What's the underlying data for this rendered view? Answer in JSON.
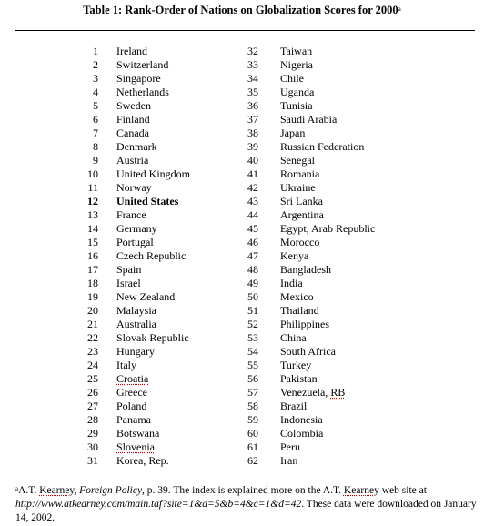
{
  "title": {
    "text": "Table 1:  Rank-Order of Nations on Globalization Scores for 2000",
    "footnote_marker": "a"
  },
  "rankings": {
    "left_column": [
      {
        "rank": "1",
        "nation": "Ireland"
      },
      {
        "rank": "2",
        "nation": "Switzerland"
      },
      {
        "rank": "3",
        "nation": "Singapore"
      },
      {
        "rank": "4",
        "nation": "Netherlands"
      },
      {
        "rank": "5",
        "nation": "Sweden"
      },
      {
        "rank": "6",
        "nation": "Finland"
      },
      {
        "rank": "7",
        "nation": "Canada"
      },
      {
        "rank": "8",
        "nation": "Denmark"
      },
      {
        "rank": "9",
        "nation": "Austria"
      },
      {
        "rank": "10",
        "nation": "United Kingdom"
      },
      {
        "rank": "11",
        "nation": "Norway"
      },
      {
        "rank": "12",
        "nation": "United States",
        "emphasis": "bold"
      },
      {
        "rank": "13",
        "nation": "France"
      },
      {
        "rank": "14",
        "nation": "Germany"
      },
      {
        "rank": "15",
        "nation": "Portugal"
      },
      {
        "rank": "16",
        "nation": "Czech Republic"
      },
      {
        "rank": "17",
        "nation": "Spain"
      },
      {
        "rank": "18",
        "nation": "Israel"
      },
      {
        "rank": "19",
        "nation": "New Zealand"
      },
      {
        "rank": "20",
        "nation": "Malaysia"
      },
      {
        "rank": "21",
        "nation": "Australia"
      },
      {
        "rank": "22",
        "nation": "Slovak Republic"
      },
      {
        "rank": "23",
        "nation": "Hungary"
      },
      {
        "rank": "24",
        "nation": "Italy"
      },
      {
        "rank": "25",
        "nation": "Croatia",
        "spellcheck_flag": true
      },
      {
        "rank": "26",
        "nation": "Greece"
      },
      {
        "rank": "27",
        "nation": "Poland"
      },
      {
        "rank": "28",
        "nation": "Panama"
      },
      {
        "rank": "29",
        "nation": "Botswana"
      },
      {
        "rank": "30",
        "nation": "Slovenia",
        "spellcheck_flag": true
      },
      {
        "rank": "31",
        "nation": "Korea, Rep."
      }
    ],
    "right_column": [
      {
        "rank": "32",
        "nation": "Taiwan"
      },
      {
        "rank": "33",
        "nation": "Nigeria"
      },
      {
        "rank": "34",
        "nation": "Chile"
      },
      {
        "rank": "35",
        "nation": "Uganda"
      },
      {
        "rank": "36",
        "nation": "Tunisia"
      },
      {
        "rank": "37",
        "nation": "Saudi Arabia"
      },
      {
        "rank": "38",
        "nation": "Japan"
      },
      {
        "rank": "39",
        "nation": "Russian Federation"
      },
      {
        "rank": "40",
        "nation": "Senegal"
      },
      {
        "rank": "41",
        "nation": "Romania"
      },
      {
        "rank": "42",
        "nation": "Ukraine"
      },
      {
        "rank": "43",
        "nation": "Sri Lanka"
      },
      {
        "rank": "44",
        "nation": "Argentina"
      },
      {
        "rank": "45",
        "nation": "Egypt, Arab Republic"
      },
      {
        "rank": "46",
        "nation": "Morocco"
      },
      {
        "rank": "47",
        "nation": "Kenya"
      },
      {
        "rank": "48",
        "nation": "Bangladesh"
      },
      {
        "rank": "49",
        "nation": "India"
      },
      {
        "rank": "50",
        "nation": "Mexico"
      },
      {
        "rank": "51",
        "nation": "Thailand"
      },
      {
        "rank": "52",
        "nation": "Philippines"
      },
      {
        "rank": "53",
        "nation": "China"
      },
      {
        "rank": "54",
        "nation": "South Africa"
      },
      {
        "rank": "55",
        "nation": "Turkey"
      },
      {
        "rank": "56",
        "nation": "Pakistan"
      },
      {
        "rank": "57",
        "nation": "Venezuela, RB",
        "spellcheck_fragment": "RB"
      },
      {
        "rank": "58",
        "nation": "Brazil"
      },
      {
        "rank": "59",
        "nation": "Indonesia"
      },
      {
        "rank": "60",
        "nation": "Colombia"
      },
      {
        "rank": "61",
        "nation": "Peru"
      },
      {
        "rank": "62",
        "nation": "Iran"
      }
    ]
  },
  "footnote": {
    "marker": "a",
    "author_prefix": "A.T. ",
    "author_name": "Kearney",
    "sep1": ", ",
    "source": "Foreign Policy",
    "text1": ", p. 39.  The index is explained more on the A.T. ",
    "author_name2": "Kearney",
    "text2": " web site at",
    "url": "http://www.atkearney.com/main.taf?site=1&a=5&b=4&c=1&d=42",
    "text3": ".  These data were downloaded on January 14, 2002."
  },
  "colors": {
    "text": "#000000",
    "rule": "#000000",
    "spellcheck_underline": "#d00000",
    "background": "#ffffff"
  }
}
